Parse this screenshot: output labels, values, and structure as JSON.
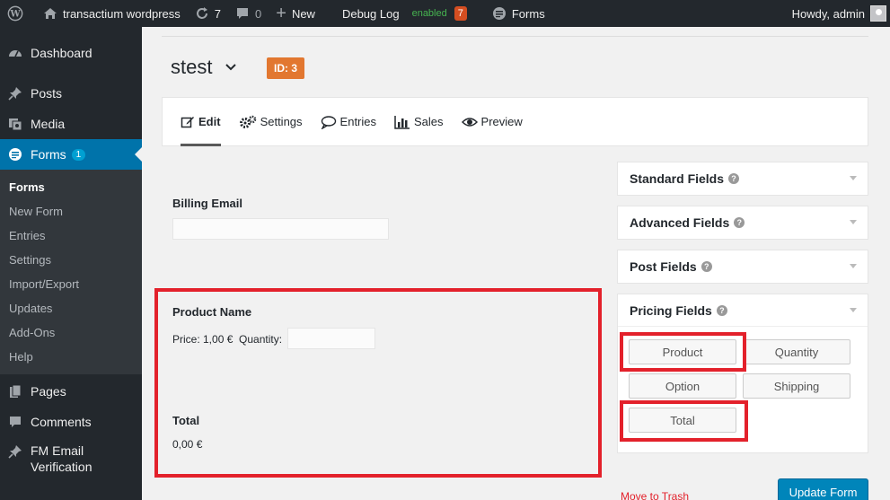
{
  "admin_bar": {
    "site_name": "transactium wordpress",
    "updates_count": "7",
    "comments_count": "0",
    "new_label": "New",
    "debug_label": "Debug Log",
    "debug_status": "enabled",
    "debug_count": "7",
    "forms_label": "Forms",
    "greeting": "Howdy, admin"
  },
  "sidebar": {
    "dashboard": "Dashboard",
    "posts": "Posts",
    "media": "Media",
    "forms": "Forms",
    "forms_badge": "1",
    "submenu": [
      "Forms",
      "New Form",
      "Entries",
      "Settings",
      "Import/Export",
      "Updates",
      "Add-Ons",
      "Help"
    ],
    "pages": "Pages",
    "comments": "Comments",
    "fm_email_line1": "FM Email",
    "fm_email_line2": "Verification"
  },
  "header": {
    "form_title": "stest",
    "id_badge": "ID: 3"
  },
  "tabs": [
    "Edit",
    "Settings",
    "Entries",
    "Sales",
    "Preview"
  ],
  "form": {
    "billing_email_label": "Billing Email",
    "product_name_label": "Product Name",
    "price_text": "Price: 1,00 €  Quantity:",
    "total_label": "Total",
    "total_value": "0,00 €"
  },
  "panels": {
    "standard": "Standard Fields",
    "advanced": "Advanced Fields",
    "post": "Post Fields",
    "pricing": "Pricing Fields",
    "pricing_buttons": [
      "Product",
      "Quantity",
      "Option",
      "Shipping",
      "Total"
    ]
  },
  "actions": {
    "trash": "Move to Trash",
    "update": "Update Form"
  },
  "colors": {
    "admin_bar_bg": "#23282d",
    "accent_blue": "#0073aa",
    "id_badge": "#e27730",
    "highlight_red": "#e3212b",
    "update_button": "#0085ba"
  }
}
